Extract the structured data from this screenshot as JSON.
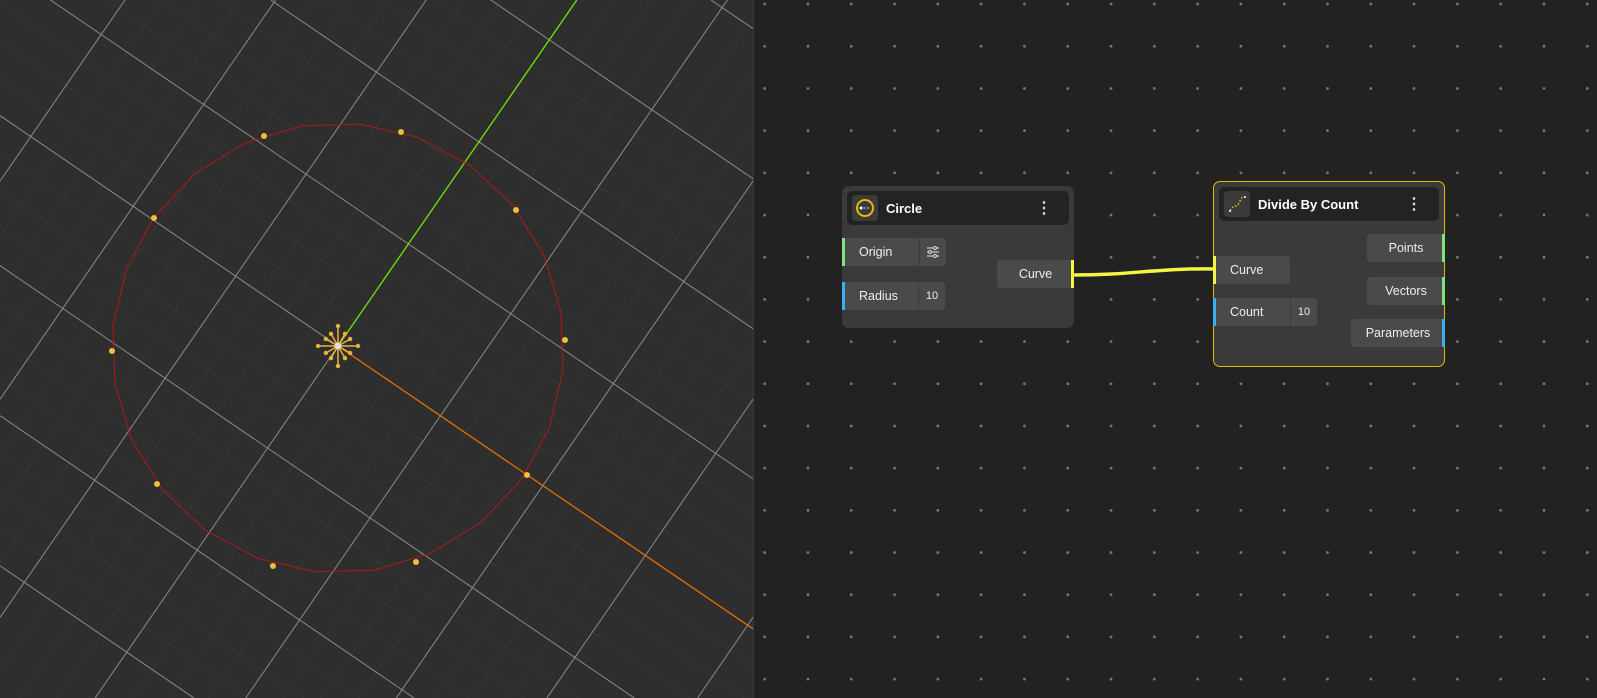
{
  "viewport": {
    "axis_colors": {
      "x": "#e06a00",
      "y": "#6fe000",
      "curve": "#b01818",
      "points": "#e8c23a"
    }
  },
  "nodes": {
    "circle": {
      "title": "Circle",
      "menu": "⋮",
      "inputs": {
        "origin": "Origin",
        "radius": "Radius",
        "radius_value": "10"
      },
      "output": "Curve"
    },
    "divide": {
      "title": "Divide By Count",
      "menu": "⋮",
      "inputs": {
        "curve": "Curve",
        "count": "Count",
        "count_value": "10"
      },
      "outputs": {
        "points": "Points",
        "vectors": "Vectors",
        "parameters": "Parameters"
      }
    }
  },
  "colors": {
    "wire": "#f5f542",
    "green_port": "#7ee37e",
    "blue_port": "#3aaef0",
    "yellow_port": "#f5f542",
    "selected": "#e6b800"
  }
}
